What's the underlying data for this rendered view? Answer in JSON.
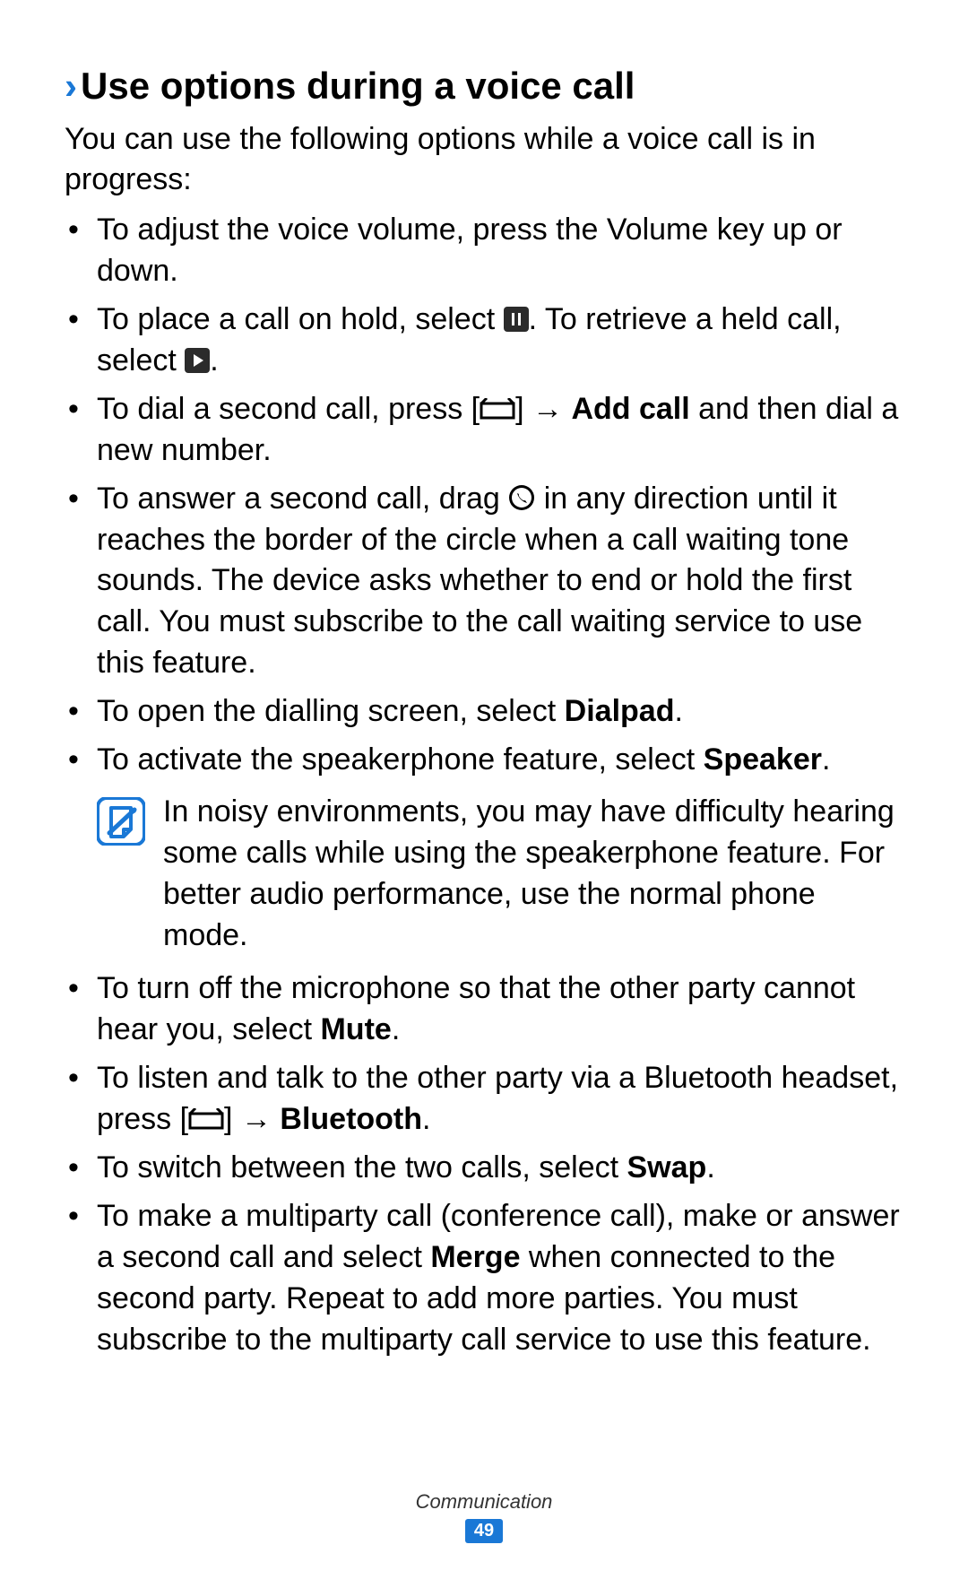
{
  "heading": {
    "chevron": "›",
    "title": "Use options during a voice call"
  },
  "intro": "You can use the following options while a voice call is in progress:",
  "bullets1": {
    "b0": "To adjust the voice volume, press the Volume key up or down.",
    "b1_a": "To place a call on hold, select ",
    "b1_b": ". To retrieve a held call, select ",
    "b1_c": ".",
    "b2_a": "To dial a second call, press [",
    "b2_b": "] → ",
    "b2_bold": "Add call",
    "b2_c": " and then dial a new number.",
    "b3_a": "To answer a second call, drag ",
    "b3_b": " in any direction until it reaches the border of the circle when a call waiting tone sounds. The device asks whether to end or hold the first call. You must subscribe to the call waiting service to use this feature.",
    "b4_a": "To open the dialling screen, select ",
    "b4_bold": "Dialpad",
    "b4_c": ".",
    "b5_a": "To activate the speakerphone feature, select ",
    "b5_bold": "Speaker",
    "b5_c": "."
  },
  "note": "In noisy environments, you may have difficulty hearing some calls while using the speakerphone feature. For better audio performance, use the normal phone mode.",
  "bullets2": {
    "b0_a": "To turn off the microphone so that the other party cannot hear you, select ",
    "b0_bold": "Mute",
    "b0_c": ".",
    "b1_a": "To listen and talk to the other party via a Bluetooth headset, press [",
    "b1_b": "] → ",
    "b1_bold": "Bluetooth",
    "b1_c": ".",
    "b2_a": "To switch between the two calls, select ",
    "b2_bold": "Swap",
    "b2_c": ".",
    "b3_a": "To make a multiparty call (conference call), make or answer a second call and select ",
    "b3_bold": "Merge",
    "b3_c": " when connected to the second party. Repeat to add more parties. You must subscribe to the multiparty call service to use this feature."
  },
  "footer": {
    "section": "Communication",
    "page": "49"
  }
}
